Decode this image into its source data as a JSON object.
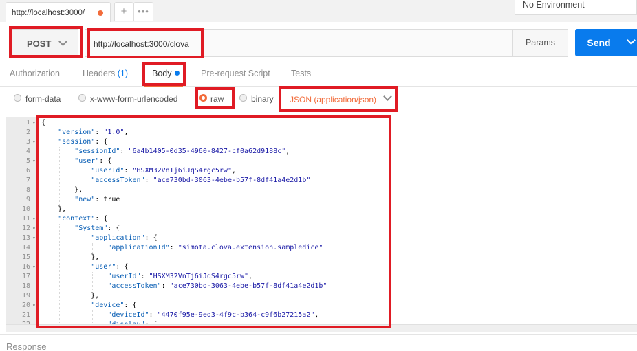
{
  "tabs": {
    "request_tab_title": "http://localhost:3000/",
    "add_symbol": "+",
    "more_symbol": "•••"
  },
  "environment": {
    "selected": "No Environment"
  },
  "request": {
    "method": "POST",
    "url": "http://localhost:3000/clova",
    "params_label": "Params",
    "send_label": "Send"
  },
  "request_tabs": {
    "authorization": "Authorization",
    "headers": "Headers",
    "headers_count": "(1)",
    "body": "Body",
    "prerequest": "Pre-request Script",
    "tests": "Tests"
  },
  "body_type": {
    "form_data": "form-data",
    "urlencoded": "x-www-form-urlencoded",
    "raw": "raw",
    "binary": "binary",
    "content_type": "JSON (application/json)",
    "selected": "raw"
  },
  "editor": {
    "lines": [
      {
        "n": "1",
        "fold": true,
        "indent": 0,
        "segs": [
          [
            "p",
            "{"
          ]
        ]
      },
      {
        "n": "2",
        "fold": false,
        "indent": 1,
        "segs": [
          [
            "k",
            "\"version\""
          ],
          [
            "p",
            ": "
          ],
          [
            "s",
            "\"1.0\""
          ],
          [
            "p",
            ","
          ]
        ]
      },
      {
        "n": "3",
        "fold": true,
        "indent": 1,
        "segs": [
          [
            "k",
            "\"session\""
          ],
          [
            "p",
            ": {"
          ]
        ]
      },
      {
        "n": "4",
        "fold": false,
        "indent": 2,
        "segs": [
          [
            "k",
            "\"sessionId\""
          ],
          [
            "p",
            ": "
          ],
          [
            "s",
            "\"6a4b1405-0d35-4960-8427-cf0a62d9188c\""
          ],
          [
            "p",
            ","
          ]
        ]
      },
      {
        "n": "5",
        "fold": true,
        "indent": 2,
        "segs": [
          [
            "k",
            "\"user\""
          ],
          [
            "p",
            ": {"
          ]
        ]
      },
      {
        "n": "6",
        "fold": false,
        "indent": 3,
        "segs": [
          [
            "k",
            "\"userId\""
          ],
          [
            "p",
            ": "
          ],
          [
            "s",
            "\"HSXM32VnTj6iJqS4rgc5rw\""
          ],
          [
            "p",
            ","
          ]
        ]
      },
      {
        "n": "7",
        "fold": false,
        "indent": 3,
        "segs": [
          [
            "k",
            "\"accessToken\""
          ],
          [
            "p",
            ": "
          ],
          [
            "s",
            "\"ace730bd-3063-4ebe-b57f-8df41a4e2d1b\""
          ]
        ]
      },
      {
        "n": "8",
        "fold": false,
        "indent": 2,
        "segs": [
          [
            "p",
            "},"
          ]
        ]
      },
      {
        "n": "9",
        "fold": false,
        "indent": 2,
        "segs": [
          [
            "k",
            "\"new\""
          ],
          [
            "p",
            ": true"
          ]
        ]
      },
      {
        "n": "10",
        "fold": false,
        "indent": 1,
        "segs": [
          [
            "p",
            "},"
          ]
        ]
      },
      {
        "n": "11",
        "fold": true,
        "indent": 1,
        "segs": [
          [
            "k",
            "\"context\""
          ],
          [
            "p",
            ": {"
          ]
        ]
      },
      {
        "n": "12",
        "fold": true,
        "indent": 2,
        "segs": [
          [
            "k",
            "\"System\""
          ],
          [
            "p",
            ": {"
          ]
        ]
      },
      {
        "n": "13",
        "fold": true,
        "indent": 3,
        "segs": [
          [
            "k",
            "\"application\""
          ],
          [
            "p",
            ": {"
          ]
        ]
      },
      {
        "n": "14",
        "fold": false,
        "indent": 4,
        "segs": [
          [
            "k",
            "\"applicationId\""
          ],
          [
            "p",
            ": "
          ],
          [
            "s",
            "\"simota.clova.extension.sampledice\""
          ]
        ]
      },
      {
        "n": "15",
        "fold": false,
        "indent": 3,
        "segs": [
          [
            "p",
            "},"
          ]
        ]
      },
      {
        "n": "16",
        "fold": true,
        "indent": 3,
        "segs": [
          [
            "k",
            "\"user\""
          ],
          [
            "p",
            ": {"
          ]
        ]
      },
      {
        "n": "17",
        "fold": false,
        "indent": 4,
        "segs": [
          [
            "k",
            "\"userId\""
          ],
          [
            "p",
            ": "
          ],
          [
            "s",
            "\"HSXM32VnTj6iJqS4rgc5rw\""
          ],
          [
            "p",
            ","
          ]
        ]
      },
      {
        "n": "18",
        "fold": false,
        "indent": 4,
        "segs": [
          [
            "k",
            "\"accessToken\""
          ],
          [
            "p",
            ": "
          ],
          [
            "s",
            "\"ace730bd-3063-4ebe-b57f-8df41a4e2d1b\""
          ]
        ]
      },
      {
        "n": "19",
        "fold": false,
        "indent": 3,
        "segs": [
          [
            "p",
            "},"
          ]
        ]
      },
      {
        "n": "20",
        "fold": true,
        "indent": 3,
        "segs": [
          [
            "k",
            "\"device\""
          ],
          [
            "p",
            ": {"
          ]
        ]
      },
      {
        "n": "21",
        "fold": false,
        "indent": 4,
        "segs": [
          [
            "k",
            "\"deviceId\""
          ],
          [
            "p",
            ": "
          ],
          [
            "s",
            "\"4470f95e-9ed3-4f9c-b364-c9f6b27215a2\""
          ],
          [
            "p",
            ","
          ]
        ]
      },
      {
        "n": "22",
        "fold": true,
        "indent": 4,
        "segs": [
          [
            "k",
            "\"display\""
          ],
          [
            "p",
            ": {"
          ]
        ]
      }
    ]
  },
  "response": {
    "label": "Response"
  },
  "colors": {
    "accent_orange": "#f26b3a",
    "send_blue": "#097bed",
    "highlight_red": "#e01b24",
    "json_key": "#0a5fb5",
    "json_string": "#1a1aa6"
  },
  "icons": {
    "tab_unsaved": "unsaved-dot-icon",
    "method_dropdown": "chevron-down-icon",
    "send_dropdown": "chevron-down-icon",
    "body_modified": "modified-dot-icon"
  }
}
